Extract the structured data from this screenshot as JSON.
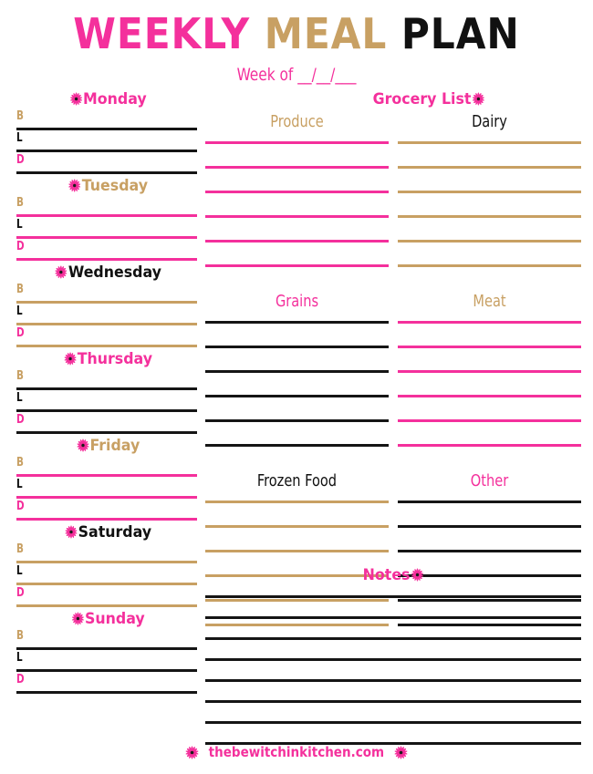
{
  "header": {
    "title_words": [
      {
        "text": "WEEKLY",
        "color": "#F4309C"
      },
      {
        "text": "MEAL",
        "color": "#C8A063"
      },
      {
        "text": "PLAN",
        "color": "#111111"
      }
    ],
    "title_word_1": "WEEKLY",
    "title_word_2": "MEAL",
    "title_word_3": "PLAN",
    "subtitle": "Week of __/__/___"
  },
  "meal_labels": {
    "breakfast": "B",
    "lunch": "L",
    "dinner": "D"
  },
  "days": [
    {
      "name": "Monday",
      "name_color": "#F4309C",
      "line_color": "#151515",
      "lines": 3
    },
    {
      "name": "Tuesday",
      "name_color": "#C8A063",
      "line_color": "#F4309C",
      "lines": 3
    },
    {
      "name": "Wednesday",
      "name_color": "#111111",
      "line_color": "#C8A063",
      "lines": 3
    },
    {
      "name": "Thursday",
      "name_color": "#F4309C",
      "line_color": "#151515",
      "lines": 3
    },
    {
      "name": "Friday",
      "name_color": "#C8A063",
      "line_color": "#F4309C",
      "lines": 3
    },
    {
      "name": "Saturday",
      "name_color": "#111111",
      "line_color": "#C8A063",
      "lines": 3
    },
    {
      "name": "Sunday",
      "name_color": "#F4309C",
      "line_color": "#151515",
      "lines": 3
    }
  ],
  "grocery": {
    "title": "Grocery List",
    "categories": [
      {
        "name": "Produce",
        "name_color": "#C8A063",
        "line_color": "#F4309C",
        "lines": 6
      },
      {
        "name": "Dairy",
        "name_color": "#111111",
        "line_color": "#C8A063",
        "lines": 6
      },
      {
        "name": "Grains",
        "name_color": "#F4309C",
        "line_color": "#151515",
        "lines": 6
      },
      {
        "name": "Meat",
        "name_color": "#C8A063",
        "line_color": "#F4309C",
        "lines": 6
      },
      {
        "name": "Frozen Food",
        "name_color": "#111111",
        "line_color": "#C8A063",
        "lines": 6
      },
      {
        "name": "Other",
        "name_color": "#F4309C",
        "line_color": "#151515",
        "lines": 6
      }
    ]
  },
  "notes": {
    "title": "Notes",
    "line_color": "#151515",
    "lines": 8
  },
  "footer": {
    "site": "thebewitchinkitchen.com"
  },
  "icons": {
    "flower": "flower-starburst-icon"
  },
  "palette": {
    "pink": "#F4309C",
    "gold": "#C8A063",
    "black": "#151515",
    "background": "#FFFFFF"
  }
}
